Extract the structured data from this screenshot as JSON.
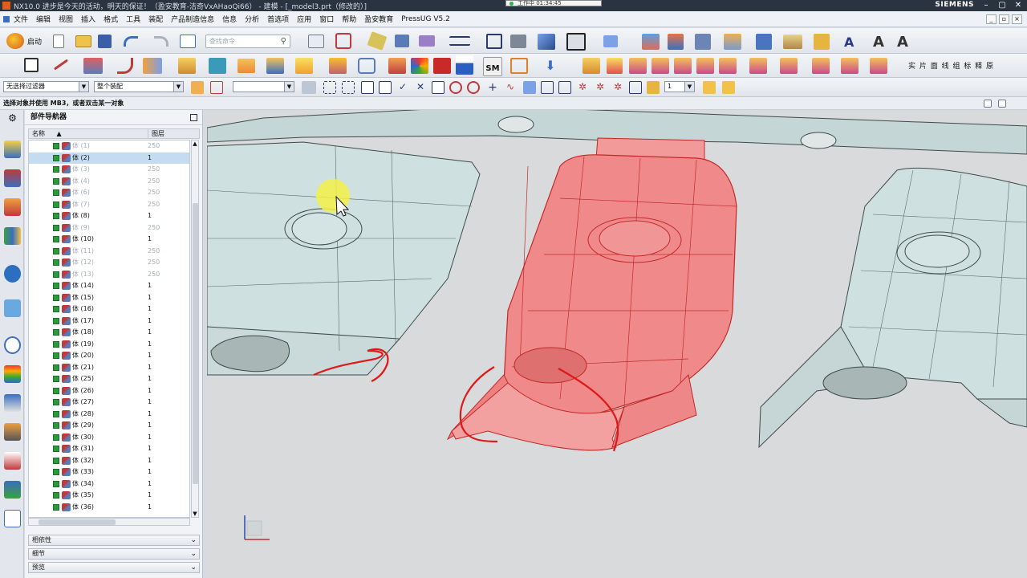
{
  "window": {
    "title": "NX10.0 进步是今天的活动，明天的保证！（盈安教育-洁奇VxAHaoQi66） - 建模 - [_model3.prt（修改的）]",
    "recording": "工作中 01:34:45",
    "brand": "SIEMENS"
  },
  "menu": [
    "文件",
    "编辑",
    "视图",
    "插入",
    "格式",
    "工具",
    "装配",
    "产品制造信息",
    "信息",
    "分析",
    "首选项",
    "应用",
    "窗口",
    "帮助",
    "盈安教育",
    "PressUG V5.2"
  ],
  "toolbar": {
    "start_label": "启动",
    "search_placeholder": "查找命令",
    "text_buttons": "实 片 面 线 组 标 释 原",
    "filter_select": "无选择过滤器",
    "scope_select": "整个装配",
    "layer_value": "1"
  },
  "cue_line": "选择对象并使用 MB3，或者双击某一对象",
  "navigator": {
    "title": "部件导航器",
    "col_name": "名称",
    "col_layer": "图层",
    "rows": [
      {
        "name": "体 (1)",
        "layer": "250",
        "dim": true
      },
      {
        "name": "体 (2)",
        "layer": "1",
        "dim": false,
        "selected": true
      },
      {
        "name": "体 (3)",
        "layer": "250",
        "dim": true
      },
      {
        "name": "体 (4)",
        "layer": "250",
        "dim": true
      },
      {
        "name": "体 (6)",
        "layer": "250",
        "dim": true
      },
      {
        "name": "体 (7)",
        "layer": "250",
        "dim": true
      },
      {
        "name": "体 (8)",
        "layer": "1",
        "dim": false
      },
      {
        "name": "体 (9)",
        "layer": "250",
        "dim": true
      },
      {
        "name": "体 (10)",
        "layer": "1",
        "dim": false
      },
      {
        "name": "体 (11)",
        "layer": "250",
        "dim": true
      },
      {
        "name": "体 (12)",
        "layer": "250",
        "dim": true
      },
      {
        "name": "体 (13)",
        "layer": "250",
        "dim": true
      },
      {
        "name": "体 (14)",
        "layer": "1",
        "dim": false
      },
      {
        "name": "体 (15)",
        "layer": "1",
        "dim": false
      },
      {
        "name": "体 (16)",
        "layer": "1",
        "dim": false
      },
      {
        "name": "体 (17)",
        "layer": "1",
        "dim": false
      },
      {
        "name": "体 (18)",
        "layer": "1",
        "dim": false
      },
      {
        "name": "体 (19)",
        "layer": "1",
        "dim": false
      },
      {
        "name": "体 (20)",
        "layer": "1",
        "dim": false
      },
      {
        "name": "体 (21)",
        "layer": "1",
        "dim": false
      },
      {
        "name": "体 (25)",
        "layer": "1",
        "dim": false
      },
      {
        "name": "体 (26)",
        "layer": "1",
        "dim": false
      },
      {
        "name": "体 (27)",
        "layer": "1",
        "dim": false
      },
      {
        "name": "体 (28)",
        "layer": "1",
        "dim": false
      },
      {
        "name": "体 (29)",
        "layer": "1",
        "dim": false
      },
      {
        "name": "体 (30)",
        "layer": "1",
        "dim": false
      },
      {
        "name": "体 (31)",
        "layer": "1",
        "dim": false
      },
      {
        "name": "体 (32)",
        "layer": "1",
        "dim": false
      },
      {
        "name": "体 (33)",
        "layer": "1",
        "dim": false
      },
      {
        "name": "体 (34)",
        "layer": "1",
        "dim": false
      },
      {
        "name": "体 (35)",
        "layer": "1",
        "dim": false
      },
      {
        "name": "体 (36)",
        "layer": "1",
        "dim": false
      }
    ],
    "panels": [
      "相依性",
      "细节",
      "预览"
    ]
  },
  "colors": {
    "accent_red": "#e23a3a",
    "selected_row": "#c4dcf2",
    "part_fill": "#cfe0e0"
  }
}
